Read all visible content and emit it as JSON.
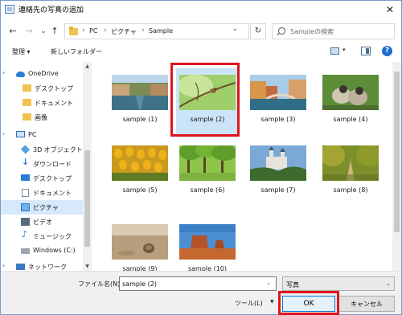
{
  "window": {
    "title": "連絡先の写真の追加",
    "close_glyph": "✕"
  },
  "nav": {
    "back_glyph": "←",
    "forward_glyph": "→",
    "recent_glyph": "⌄",
    "up_glyph": "↑",
    "breadcrumb": [
      "PC",
      "ピクチャ",
      "Sample"
    ],
    "breadcrumb_sep": "›",
    "refresh_glyph": "↻",
    "dropdown_glyph": "⌄",
    "search_placeholder": "Sampleの検索"
  },
  "toolbar": {
    "organize": "整理 ▾",
    "new_folder": "新しいフォルダー",
    "help": "?",
    "view_chev": "▾",
    "icons": [
      "view-icon",
      "preview-pane-icon",
      "help-icon"
    ]
  },
  "sidebar": {
    "items": [
      {
        "label": "OneDrive",
        "icon": "cloud-icon"
      },
      {
        "label": "デスクトップ",
        "icon": "folder-icon"
      },
      {
        "label": "ドキュメント",
        "icon": "folder-icon"
      },
      {
        "label": "画像",
        "icon": "folder-icon"
      },
      {
        "label": "PC",
        "icon": "pc-icon"
      },
      {
        "label": "3D オブジェクト",
        "icon": "3d-objects-icon"
      },
      {
        "label": "ダウンロード",
        "icon": "download-icon"
      },
      {
        "label": "デスクトップ",
        "icon": "desktop-icon"
      },
      {
        "label": "ドキュメント",
        "icon": "document-icon"
      },
      {
        "label": "ピクチャ",
        "icon": "pictures-icon",
        "selected": true
      },
      {
        "label": "ビデオ",
        "icon": "video-icon"
      },
      {
        "label": "ミュージック",
        "icon": "music-icon"
      },
      {
        "label": "Windows (C:)",
        "icon": "drive-icon"
      },
      {
        "label": "ネットワーク",
        "icon": "network-icon"
      }
    ],
    "scroll_up": "▲",
    "scroll_down": "▼",
    "expand_glyph": "›"
  },
  "files": [
    {
      "name": "sample (1)",
      "scene": "canal"
    },
    {
      "name": "sample (2)",
      "scene": "bird-branch",
      "selected": true
    },
    {
      "name": "sample (3)",
      "scene": "venice"
    },
    {
      "name": "sample (4)",
      "scene": "ducklings"
    },
    {
      "name": "sample (5)",
      "scene": "tulips"
    },
    {
      "name": "sample (6)",
      "scene": "forest"
    },
    {
      "name": "sample (7)",
      "scene": "castle"
    },
    {
      "name": "sample (8)",
      "scene": "autumn-path"
    },
    {
      "name": "sample (9)",
      "scene": "beach-shell"
    },
    {
      "name": "sample (10)",
      "scene": "desert-butte"
    }
  ],
  "bottom": {
    "filename_label": "ファイル名(N):",
    "filename_value": "sample (2)",
    "filename_chev": "⌄",
    "filetype_value": "写真",
    "filetype_chev": "⌄",
    "tools_label": "ツール(L)",
    "tools_chev": "▼",
    "ok_label": "OK",
    "cancel_label": "キャンセル"
  },
  "colors": {
    "highlight_red": "#e0141e",
    "selection_blue": "#cce4f7",
    "accent": "#0078d7"
  }
}
